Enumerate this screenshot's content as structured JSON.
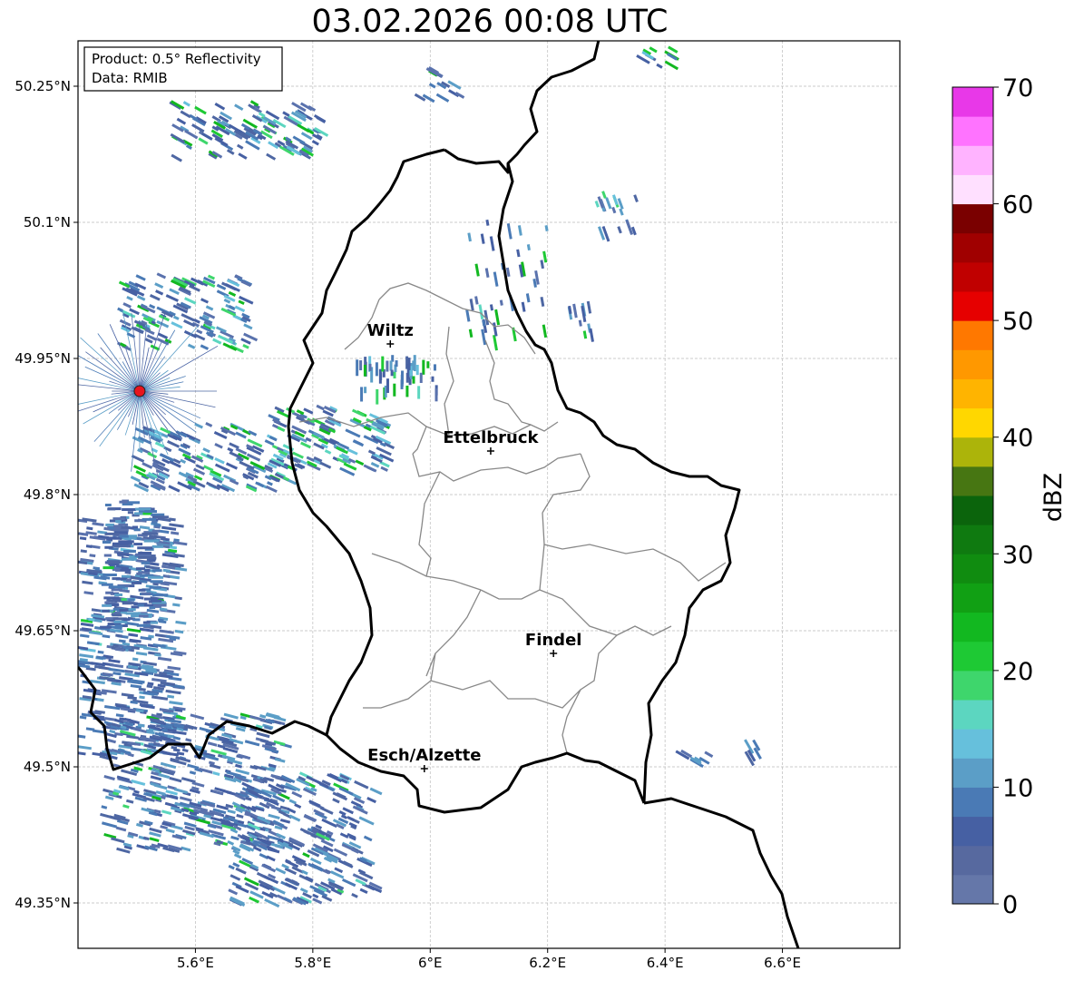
{
  "title": "03.02.2026 00:08 UTC",
  "info_box": {
    "product": "Product: 0.5° Reflectivity",
    "data": "Data: RMIB"
  },
  "map": {
    "lon_range": [
      5.4,
      6.8
    ],
    "lat_range": [
      49.3,
      50.3
    ],
    "x_ticks": [
      "5.6°E",
      "5.8°E",
      "6°E",
      "6.2°E",
      "6.4°E",
      "6.6°E"
    ],
    "x_tick_values": [
      5.6,
      5.8,
      6.0,
      6.2,
      6.4,
      6.6
    ],
    "y_ticks": [
      "50.25°N",
      "50.1°N",
      "49.95°N",
      "49.8°N",
      "49.65°N",
      "49.5°N",
      "49.35°N"
    ],
    "y_tick_values": [
      50.25,
      50.1,
      49.95,
      49.8,
      49.65,
      49.5,
      49.35
    ],
    "grid": true,
    "radar_site": {
      "lon": 5.505,
      "lat": 49.914,
      "color": "#e8141e"
    }
  },
  "cities": [
    {
      "name": "Wiltz",
      "lon": 5.932,
      "lat": 49.966
    },
    {
      "name": "Ettelbruck",
      "lon": 6.103,
      "lat": 49.848
    },
    {
      "name": "Findel",
      "lon": 6.21,
      "lat": 49.625
    },
    {
      "name": "Esch/Alzette",
      "lon": 5.99,
      "lat": 49.498
    }
  ],
  "colorbar": {
    "label": "dBZ",
    "min": 0,
    "max": 70,
    "ticks": [
      "0",
      "10",
      "20",
      "30",
      "40",
      "50",
      "60",
      "70"
    ],
    "colors": [
      "#6577a9",
      "#57699f",
      "#4660a3",
      "#4a7ab5",
      "#5b9ec7",
      "#66c0dc",
      "#5cd6c0",
      "#3ed66c",
      "#1ec934",
      "#12b820",
      "#11a014",
      "#108c10",
      "#0f7a10",
      "#0b640c",
      "#477612",
      "#acb40a",
      "#ffd700",
      "#ffb400",
      "#ff9800",
      "#ff7800",
      "#e60000",
      "#c00000",
      "#a00000",
      "#7a0000",
      "#ffe0ff",
      "#ffb3ff",
      "#ff73ff",
      "#e838e8"
    ]
  }
}
